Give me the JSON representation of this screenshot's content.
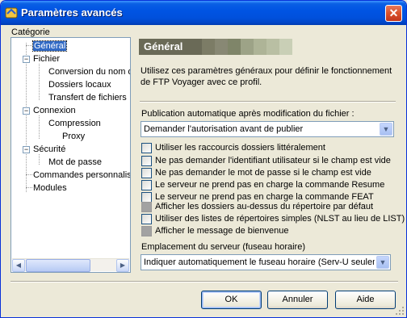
{
  "window": {
    "title": "Paramètres avancés",
    "close_glyph": "✕",
    "app_icon": "ftp-voyager-icon"
  },
  "category": {
    "label": "Catégorie",
    "tree": [
      {
        "label": "Général",
        "selected": true
      },
      {
        "label": "Fichier",
        "expanded": true
      },
      {
        "label": "Conversion du nom de"
      },
      {
        "label": "Dossiers locaux"
      },
      {
        "label": "Transfert de fichiers"
      },
      {
        "label": "Connexion",
        "expanded": true
      },
      {
        "label": "Compression"
      },
      {
        "label": "Proxy"
      },
      {
        "label": "Sécurité",
        "expanded": true
      },
      {
        "label": "Mot de passe"
      },
      {
        "label": "Commandes personnalisées"
      },
      {
        "label": "Modules"
      }
    ]
  },
  "panel": {
    "title": "Général",
    "swatch_colors": [
      "#6a6a57",
      "#7c7c66",
      "#888874",
      "#7f8569",
      "#9da387",
      "#aeb497",
      "#b9bfa3",
      "#c9cfb6"
    ],
    "description": "Utilisez ces paramètres généraux pour définir le fonctionnement de FTP Voyager avec ce profil.",
    "publish_label": "Publication automatique après modification du fichier :",
    "publish_value": "Demander l'autorisation avant de publier",
    "options": [
      {
        "label": "Utiliser les raccourcis dossiers littéralement",
        "checked": false,
        "disabled": false
      },
      {
        "label": "Ne pas demander l'identifiant utilisateur si le champ est vide",
        "checked": false,
        "disabled": false
      },
      {
        "label": "Ne pas demander le mot de passe si le champ est vide",
        "checked": false,
        "disabled": false
      },
      {
        "label": "Le serveur ne prend pas en charge la commande Resume",
        "checked": false,
        "disabled": false
      },
      {
        "label": "Le serveur ne prend pas en charge la commande FEAT",
        "checked": false,
        "disabled": false
      },
      {
        "label": "Afficher les dossiers au-dessus du répertoire par défaut",
        "checked": false,
        "disabled": true
      },
      {
        "label": "Utiliser des listes de répertoires simples (NLST au lieu de LIST)",
        "checked": false,
        "disabled": false
      },
      {
        "label": "Afficher le message de bienvenue",
        "checked": false,
        "disabled": true
      }
    ],
    "timezone_label": "Emplacement du serveur (fuseau horaire)",
    "timezone_value": "Indiquer automatiquement le fuseau horaire (Serv-U seulement)"
  },
  "buttons": {
    "ok": "OK",
    "cancel": "Annuler",
    "help": "Aide"
  },
  "colors": {
    "titlebar": "#0054e3",
    "selection": "#316ac5",
    "face": "#ece9d8"
  }
}
